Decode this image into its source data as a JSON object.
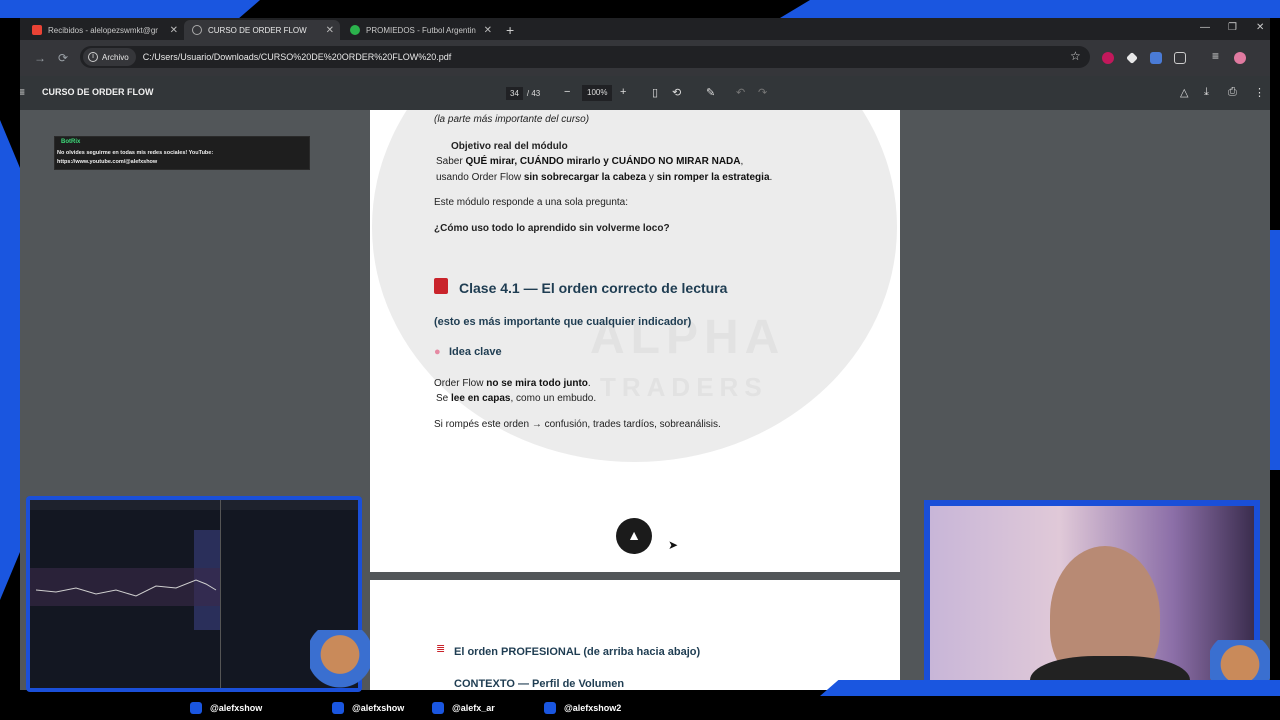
{
  "browser": {
    "tabs": [
      {
        "label": "Recibidos - alelopezswmkt@gmail",
        "icon": "gmail-icon"
      },
      {
        "label": "CURSO DE ORDER FLOW",
        "icon": "globe-icon"
      },
      {
        "label": "PROMIEDOS - Futbol Argentino",
        "icon": "promiedos-icon"
      }
    ],
    "address_chip": "Archivo",
    "url": "C:/Users/Usuario/Downloads/CURSO%20DE%20ORDER%20FLOW%20.pdf"
  },
  "pdf": {
    "title": "CURSO DE ORDER FLOW",
    "current_page": "34",
    "total_pages": "/ 43",
    "zoom": "100%"
  },
  "page1": {
    "subtitle": "(la parte más importante del curso)",
    "objetivo_heading": "Objetivo real del módulo",
    "objetivo_line1_a": "Saber ",
    "objetivo_line1_b": "QUÉ mirar, CUÁNDO mirarlo y CUÁNDO NO MIRAR NADA",
    "objetivo_line1_c": ",",
    "objetivo_line2_a": "usando Order Flow ",
    "objetivo_line2_b": "sin sobrecargar la cabeza",
    "objetivo_line2_c": " y ",
    "objetivo_line2_d": "sin romper la estrategia",
    "objetivo_line2_e": ".",
    "responde": "Este módulo responde a una sola pregunta:",
    "pregunta": "¿Cómo uso todo lo aprendido sin volverme loco?",
    "clase_title": "Clase 4.1 — El orden correcto de lectura",
    "clase_sub": "(esto es más importante que cualquier indicador)",
    "idea": "Idea clave",
    "of_a": "Order Flow ",
    "of_b": "no se mira todo junto",
    "of_c": ".",
    "capas_a": "Se ",
    "capas_b": "lee en capas",
    "capas_c": ", como un embudo.",
    "rompes": "Si rompés este orden → confusión, trades tardíos, sobreanálisis.",
    "watermark_1": "ALPHA",
    "watermark_2": "TRADERS"
  },
  "page2": {
    "orden": "El orden PROFESIONAL (de arriba hacia abajo)",
    "contexto": "CONTEXTO — Perfil de Volumen"
  },
  "overlay": {
    "botrix_name": "BotRix",
    "botrix_msg1": "No olvides seguirme en todas mis redes sociales! YouTube:",
    "botrix_msg2": "https://www.youtube.com/@alefxshow"
  },
  "socials": [
    {
      "handle": "@alefxshow",
      "icon": "tiktok-icon"
    },
    {
      "handle": "@alefxshow",
      "icon": "twitch-icon"
    },
    {
      "handle": "@alefx_ar",
      "icon": "instagram-icon"
    },
    {
      "handle": "@alefxshow2",
      "icon": "youtube-icon"
    }
  ],
  "colors": {
    "frame": "#1a56e0",
    "heading": "#1f3d52",
    "book": "#c9232b"
  }
}
